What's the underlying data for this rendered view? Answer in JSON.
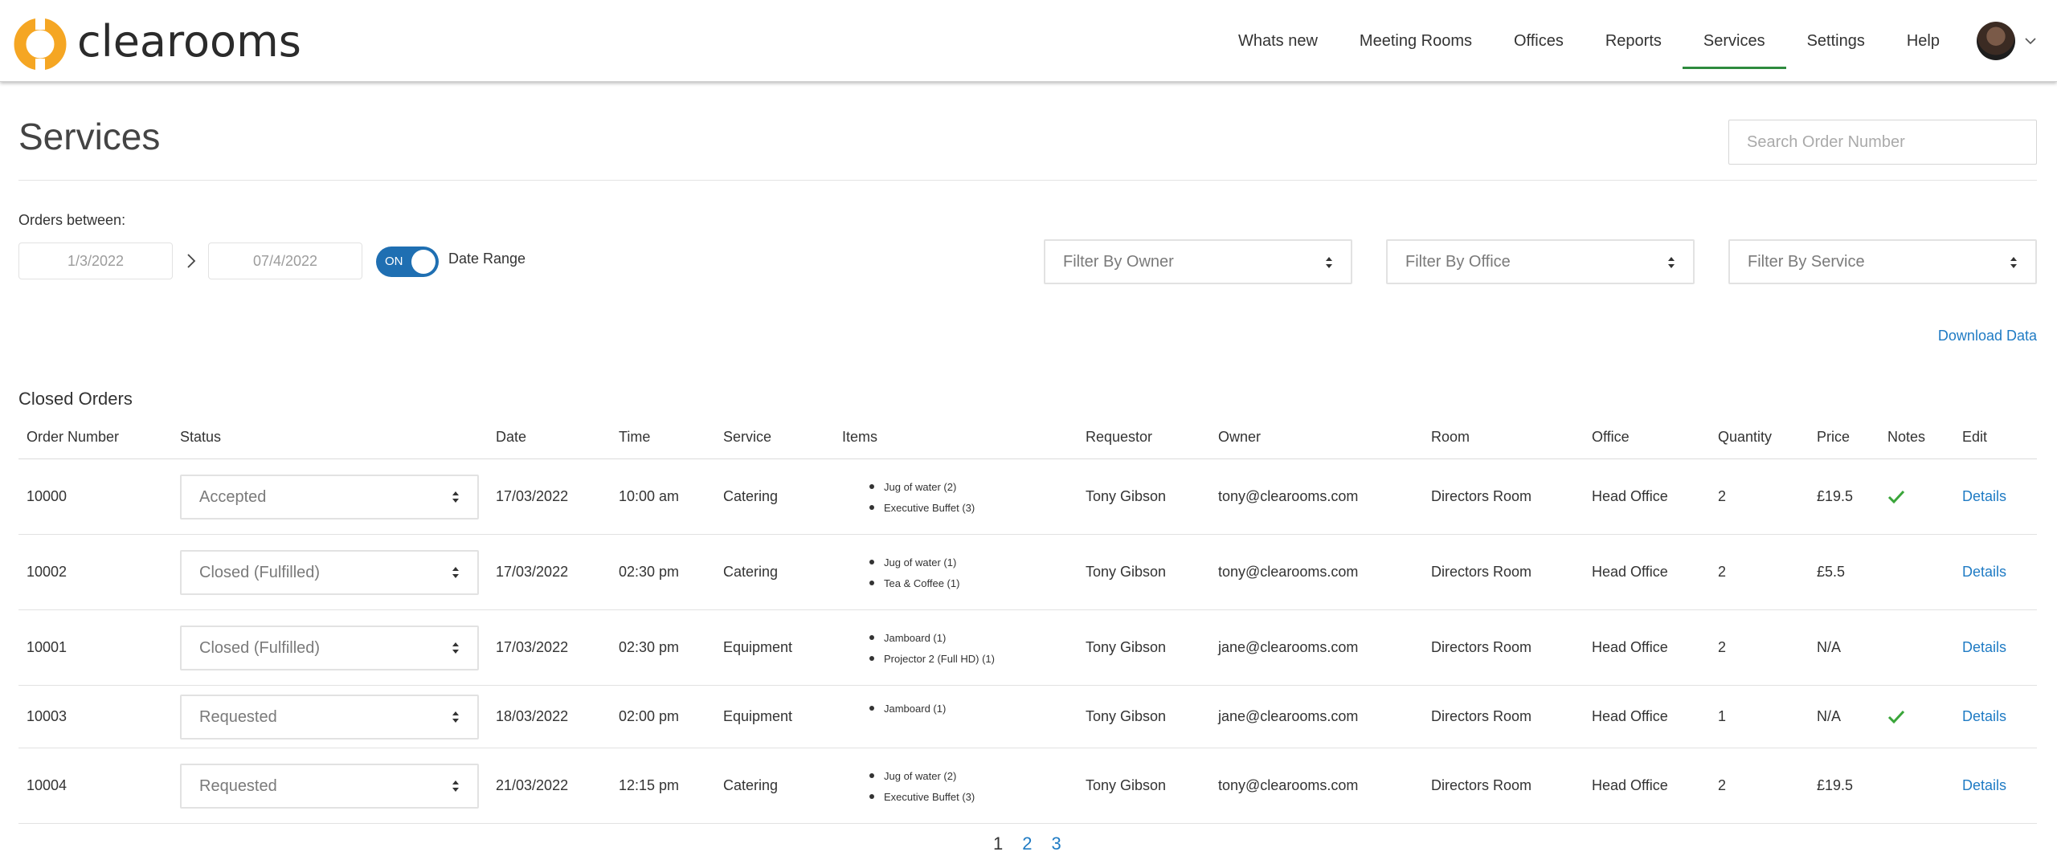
{
  "brand": {
    "name": "clearooms",
    "accent": "#f5a623"
  },
  "nav": {
    "items": [
      "Whats new",
      "Meeting Rooms",
      "Offices",
      "Reports",
      "Services",
      "Settings",
      "Help"
    ],
    "active": "Services"
  },
  "page": {
    "title": "Services"
  },
  "search": {
    "placeholder": "Search Order Number"
  },
  "filters": {
    "orders_between_label": "Orders between:",
    "start_date": "1/3/2022",
    "end_date": "07/4/2022",
    "toggle_state": "ON",
    "toggle_label": "Date Range",
    "owner_placeholder": "Filter By Owner",
    "office_placeholder": "Filter By Office",
    "service_placeholder": "Filter By Service"
  },
  "download_label": "Download Data",
  "table": {
    "title": "Closed Orders",
    "headers": [
      "Order Number",
      "Status",
      "Date",
      "Time",
      "Service",
      "Items",
      "Requestor",
      "Owner",
      "Room",
      "Office",
      "Quantity",
      "Price",
      "Notes",
      "Edit"
    ],
    "rows": [
      {
        "order": "10000",
        "status": "Accepted",
        "date": "17/03/2022",
        "time": "10:00 am",
        "service": "Catering",
        "items": [
          "Jug of water (2)",
          "Executive Buffet (3)"
        ],
        "requestor": "Tony Gibson",
        "owner": "tony@clearooms.com",
        "room": "Directors Room",
        "office": "Head Office",
        "quantity": "2",
        "price": "£19.5",
        "notes": true,
        "edit": "Details"
      },
      {
        "order": "10002",
        "status": "Closed (Fulfilled)",
        "date": "17/03/2022",
        "time": "02:30 pm",
        "service": "Catering",
        "items": [
          "Jug of water (1)",
          "Tea & Coffee (1)"
        ],
        "requestor": "Tony Gibson",
        "owner": "tony@clearooms.com",
        "room": "Directors Room",
        "office": "Head Office",
        "quantity": "2",
        "price": "£5.5",
        "notes": false,
        "edit": "Details"
      },
      {
        "order": "10001",
        "status": "Closed (Fulfilled)",
        "date": "17/03/2022",
        "time": "02:30 pm",
        "service": "Equipment",
        "items": [
          "Jamboard (1)",
          "Projector 2 (Full HD) (1)"
        ],
        "requestor": "Tony Gibson",
        "owner": "jane@clearooms.com",
        "room": "Directors Room",
        "office": "Head Office",
        "quantity": "2",
        "price": "N/A",
        "notes": false,
        "edit": "Details"
      },
      {
        "order": "10003",
        "status": "Requested",
        "date": "18/03/2022",
        "time": "02:00 pm",
        "service": "Equipment",
        "items": [
          "Jamboard (1)"
        ],
        "requestor": "Tony Gibson",
        "owner": "jane@clearooms.com",
        "room": "Directors Room",
        "office": "Head Office",
        "quantity": "1",
        "price": "N/A",
        "notes": true,
        "edit": "Details"
      },
      {
        "order": "10004",
        "status": "Requested",
        "date": "21/03/2022",
        "time": "12:15 pm",
        "service": "Catering",
        "items": [
          "Jug of water (2)",
          "Executive Buffet (3)"
        ],
        "requestor": "Tony Gibson",
        "owner": "tony@clearooms.com",
        "room": "Directors Room",
        "office": "Head Office",
        "quantity": "2",
        "price": "£19.5",
        "notes": false,
        "edit": "Details"
      }
    ]
  },
  "pagination": {
    "pages": [
      "1",
      "2",
      "3"
    ],
    "current": "1"
  },
  "colors": {
    "link": "#1f7bc4",
    "toggle": "#1f6fb2",
    "active_nav": "#2e8b3e",
    "check": "#3aa53a"
  }
}
